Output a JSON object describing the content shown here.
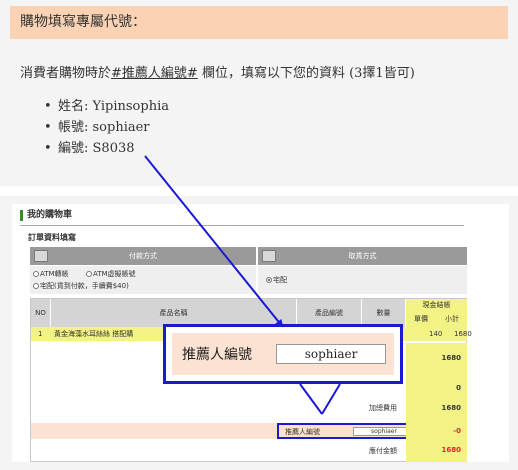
{
  "top_card": {
    "heading": "購物填寫專屬代號：",
    "intro_prefix": "消費者購物時於",
    "intro_code": "#推薦人編號#",
    "intro_suffix": " 欄位，填寫以下您的資料 (3擇1皆可)",
    "items": [
      {
        "bullet": "•",
        "label": "姓名: Yipinsophia"
      },
      {
        "bullet": "•",
        "label": "帳號: sophiaer"
      },
      {
        "bullet": "•",
        "label": "編號: S8038"
      }
    ]
  },
  "cart": {
    "title": "我的購物車",
    "form_title": "訂單資料填寫",
    "payment_header": "付款方式",
    "shipping_header": "取貨方式",
    "payment_options": [
      "ATM轉帳",
      "ATM虛擬帳號",
      "宅配(貨到付款，手續費$40)"
    ],
    "shipping_options": [
      "宅配"
    ],
    "columns": {
      "no": "NO",
      "product_name": "產品名稱",
      "product_code": "產品編號",
      "quantity": "數量",
      "money": "現金結帳",
      "unit_price": "單價",
      "subtotal": "小計"
    },
    "item": {
      "no": "1",
      "name": "黃金海藻水耳絲絲 搭配購",
      "unit_price": "140",
      "subtotal": "1680"
    },
    "summary": [
      {
        "label": "",
        "value": "1680"
      },
      {
        "label": "",
        "value": "0"
      },
      {
        "label": "加總費用",
        "value": "1680"
      }
    ],
    "referrer_label": "推薦人編號",
    "referrer_value": "sophiaer",
    "referrer_amount": "-0",
    "payable_label": "應付金額",
    "payable_value": "1680"
  },
  "callout": {
    "label": "推薦人編號",
    "value": "sophiaer"
  },
  "colors": {
    "heading_bg": "#fbd3b4",
    "highlight_blue": "#1a1ad4",
    "money_yellow": "#f3f385",
    "referrer_row": "#fbe2d2"
  }
}
